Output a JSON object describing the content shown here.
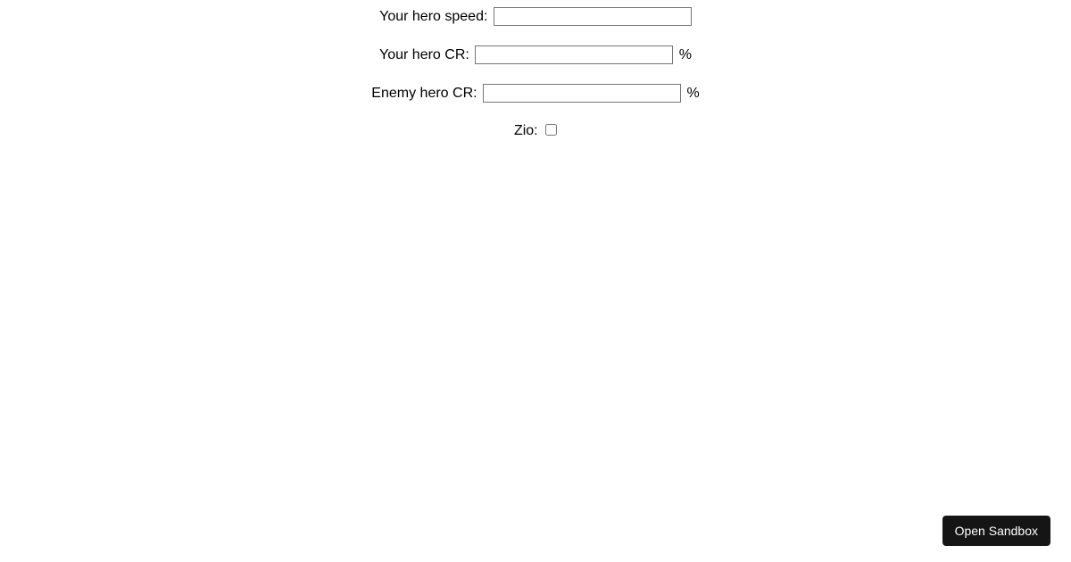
{
  "form": {
    "speed": {
      "label": "Your hero speed:",
      "value": "",
      "suffix": ""
    },
    "yourCR": {
      "label": "Your hero CR:",
      "value": "",
      "suffix": "%"
    },
    "enemyCR": {
      "label": "Enemy hero CR:",
      "value": "",
      "suffix": "%"
    },
    "zio": {
      "label": "Zio:",
      "checked": false
    }
  },
  "sandbox": {
    "button_label": "Open Sandbox"
  }
}
